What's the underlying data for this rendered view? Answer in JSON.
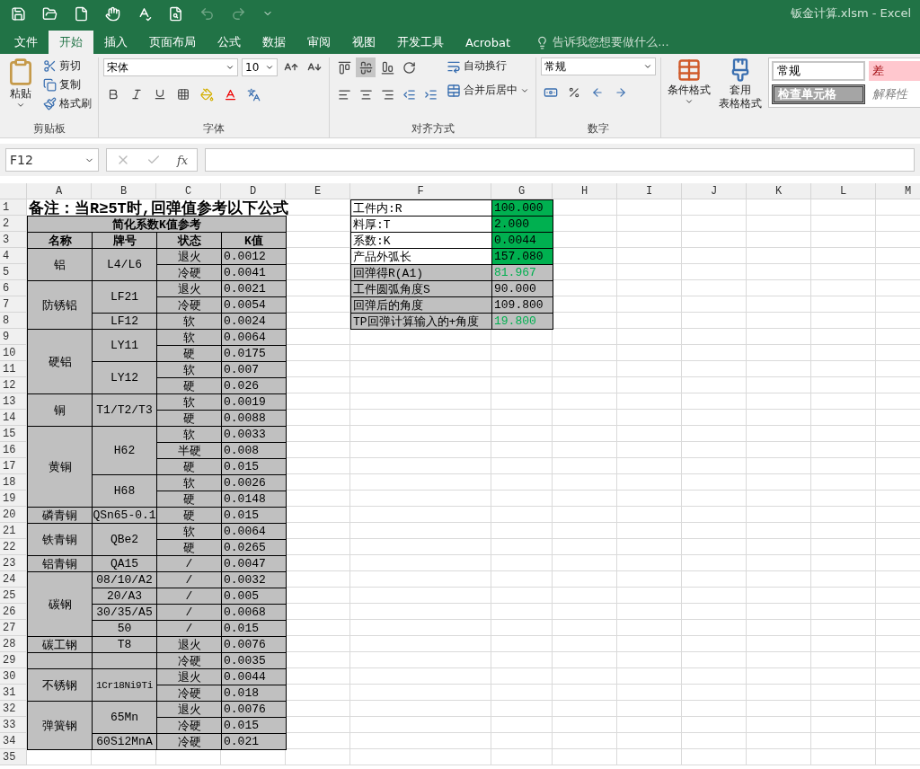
{
  "window": {
    "title": "钣金计算.xlsm - Excel"
  },
  "quick_access": [
    {
      "kind": "save",
      "disabled": false
    },
    {
      "kind": "open",
      "disabled": false
    },
    {
      "kind": "new",
      "disabled": false
    },
    {
      "kind": "touch",
      "disabled": false
    },
    {
      "kind": "spelling",
      "disabled": false
    },
    {
      "kind": "preview",
      "disabled": false
    },
    {
      "kind": "undo",
      "disabled": true
    },
    {
      "kind": "redo",
      "disabled": true
    },
    {
      "kind": "customize",
      "disabled": false
    }
  ],
  "tabs": [
    {
      "label": "文件",
      "selected": false
    },
    {
      "label": "开始",
      "selected": true
    },
    {
      "label": "插入",
      "selected": false
    },
    {
      "label": "页面布局",
      "selected": false
    },
    {
      "label": "公式",
      "selected": false
    },
    {
      "label": "数据",
      "selected": false
    },
    {
      "label": "审阅",
      "selected": false
    },
    {
      "label": "视图",
      "selected": false
    },
    {
      "label": "开发工具",
      "selected": false
    },
    {
      "label": "Acrobat",
      "selected": false
    }
  ],
  "tell_me": {
    "placeholder": "告诉我您想要做什么..."
  },
  "ribbon": {
    "clipboard": {
      "label": "剪贴板",
      "paste": "粘贴",
      "actions": [
        {
          "kind": "cut",
          "label": "剪切"
        },
        {
          "kind": "copy",
          "label": "复制"
        },
        {
          "kind": "painter",
          "label": "格式刷"
        }
      ]
    },
    "font": {
      "label": "字体",
      "family": "宋体",
      "size": "10"
    },
    "alignment": {
      "label": "对齐方式",
      "wrap": "自动换行",
      "merge": "合并后居中",
      "vertical": [
        {
          "kind": "top",
          "selected": false
        },
        {
          "kind": "middle",
          "selected": true
        },
        {
          "kind": "bottom",
          "selected": false
        }
      ]
    },
    "number": {
      "label": "数字",
      "format": "常规"
    },
    "styles": {
      "conditional": "条件格式",
      "table_format": [
        "套用",
        "表格格式"
      ],
      "cell_styles": [
        {
          "kind": "normal",
          "label": "常规"
        },
        {
          "kind": "bad",
          "label": "差"
        },
        {
          "kind": "check",
          "label": "检查单元格"
        },
        {
          "kind": "explanatory",
          "label": "解释性"
        }
      ]
    }
  },
  "formula_bar": {
    "name_box": "F12",
    "function_label": "fx"
  },
  "sheet": {
    "columns": [
      "A",
      "B",
      "C",
      "D",
      "E",
      "F",
      "G",
      "H",
      "I",
      "J",
      "K",
      "L",
      "M"
    ],
    "rows": [
      "1",
      "2",
      "3",
      "4",
      "5",
      "6",
      "7",
      "8",
      "9",
      "10",
      "11",
      "12",
      "13",
      "14",
      "15",
      "16",
      "17",
      "18",
      "19",
      "20",
      "21",
      "22",
      "23",
      "24",
      "25",
      "26",
      "27",
      "28",
      "29",
      "30",
      "31",
      "32",
      "33",
      "34",
      "35"
    ],
    "note": "备注：当R≥5T时,回弹值参考以下公式",
    "k_table": {
      "title": "简化系数K值参考",
      "headers": [
        "名称",
        "牌号",
        "状态",
        "K值"
      ],
      "materials": [
        {
          "name": "铝",
          "grades": [
            {
              "grade": "L4/L6",
              "states": [
                {
                  "state": "退火",
                  "k": "0.0012"
                },
                {
                  "state": "冷硬",
                  "k": "0.0041"
                }
              ]
            }
          ]
        },
        {
          "name": "防锈铝",
          "grades": [
            {
              "grade": "LF21",
              "states": [
                {
                  "state": "退火",
                  "k": "0.0021"
                },
                {
                  "state": "冷硬",
                  "k": "0.0054"
                }
              ]
            },
            {
              "grade": "LF12",
              "states": [
                {
                  "state": "软",
                  "k": "0.0024"
                }
              ]
            }
          ]
        },
        {
          "name": "硬铝",
          "grades": [
            {
              "grade": "LY11",
              "states": [
                {
                  "state": "软",
                  "k": "0.0064"
                },
                {
                  "state": "硬",
                  "k": "0.0175"
                }
              ]
            },
            {
              "grade": "LY12",
              "states": [
                {
                  "state": "软",
                  "k": "0.007"
                },
                {
                  "state": "硬",
                  "k": "0.026"
                }
              ]
            }
          ]
        },
        {
          "name": "铜",
          "grades": [
            {
              "grade": "T1/T2/T3",
              "states": [
                {
                  "state": "软",
                  "k": "0.0019"
                },
                {
                  "state": "硬",
                  "k": "0.0088"
                }
              ]
            }
          ]
        },
        {
          "name": "黄铜",
          "grades": [
            {
              "grade": "H62",
              "states": [
                {
                  "state": "软",
                  "k": "0.0033"
                },
                {
                  "state": "半硬",
                  "k": "0.008"
                },
                {
                  "state": "硬",
                  "k": "0.015"
                }
              ]
            },
            {
              "grade": "H68",
              "states": [
                {
                  "state": "软",
                  "k": "0.0026"
                },
                {
                  "state": "硬",
                  "k": "0.0148"
                }
              ]
            }
          ]
        },
        {
          "name": "磷青铜",
          "grades": [
            {
              "grade": "QSn65-0.1",
              "states": [
                {
                  "state": "硬",
                  "k": "0.015"
                }
              ]
            }
          ]
        },
        {
          "name": "铁青铜",
          "grades": [
            {
              "grade": "QBe2",
              "states": [
                {
                  "state": "软",
                  "k": "0.0064"
                },
                {
                  "state": "硬",
                  "k": "0.0265"
                }
              ]
            }
          ]
        },
        {
          "name": "铝青铜",
          "grades": [
            {
              "grade": "QA15",
              "states": [
                {
                  "state": "/",
                  "k": "0.0047"
                }
              ]
            }
          ]
        },
        {
          "name": "碳钢",
          "grades": [
            {
              "grade": "08/10/A2",
              "states": [
                {
                  "state": "/",
                  "k": "0.0032"
                }
              ]
            },
            {
              "grade": "20/A3",
              "states": [
                {
                  "state": "/",
                  "k": "0.005"
                }
              ]
            },
            {
              "grade": "30/35/A5",
              "states": [
                {
                  "state": "/",
                  "k": "0.0068"
                }
              ]
            },
            {
              "grade": "50",
              "states": [
                {
                  "state": "/",
                  "k": "0.015"
                }
              ]
            }
          ]
        },
        {
          "name": "碳工钢",
          "grades": [
            {
              "grade": "T8",
              "states": [
                {
                  "state": "退火",
                  "k": "0.0076"
                }
              ]
            }
          ]
        },
        {
          "grades": [
            {
              "states": [
                {
                  "state": "冷硬",
                  "k": "0.0035"
                }
              ]
            }
          ]
        },
        {
          "name": "不锈钢",
          "grades": [
            {
              "grade": "1Cr18Ni9Ti",
              "states": [
                {
                  "state": "退火",
                  "k": "0.0044"
                },
                {
                  "state": "冷硬",
                  "k": "0.018"
                }
              ]
            }
          ]
        },
        {
          "name": "弹簧钢",
          "grades": [
            {
              "grade": "65Mn",
              "states": [
                {
                  "state": "退火",
                  "k": "0.0076"
                },
                {
                  "state": "冷硬",
                  "k": "0.015"
                }
              ]
            },
            {
              "grade": "60Si2MnA",
              "states": [
                {
                  "state": "冷硬",
                  "k": "0.021"
                }
              ]
            }
          ]
        }
      ]
    },
    "calc": [
      {
        "label": "工件内:R",
        "value": "100.000",
        "kind": "input",
        "emphasis": false
      },
      {
        "label": "料厚:T",
        "value": "2.000",
        "kind": "input",
        "emphasis": false
      },
      {
        "label": "系数:K",
        "value": "0.0044",
        "kind": "input",
        "emphasis": false
      },
      {
        "label": "产品外弧长",
        "value": "157.080",
        "kind": "input",
        "emphasis": false
      },
      {
        "label": "回弹得R(A1)",
        "value": "81.967",
        "kind": "result",
        "emphasis": true
      },
      {
        "label": "工件圆弧角度S",
        "value": "90.000",
        "kind": "result",
        "emphasis": false
      },
      {
        "label": "回弹后的角度",
        "value": "109.800",
        "kind": "result",
        "emphasis": false
      },
      {
        "label": "TP回弹计算输入的+角度",
        "value": "19.800",
        "kind": "result",
        "emphasis": true
      }
    ]
  }
}
